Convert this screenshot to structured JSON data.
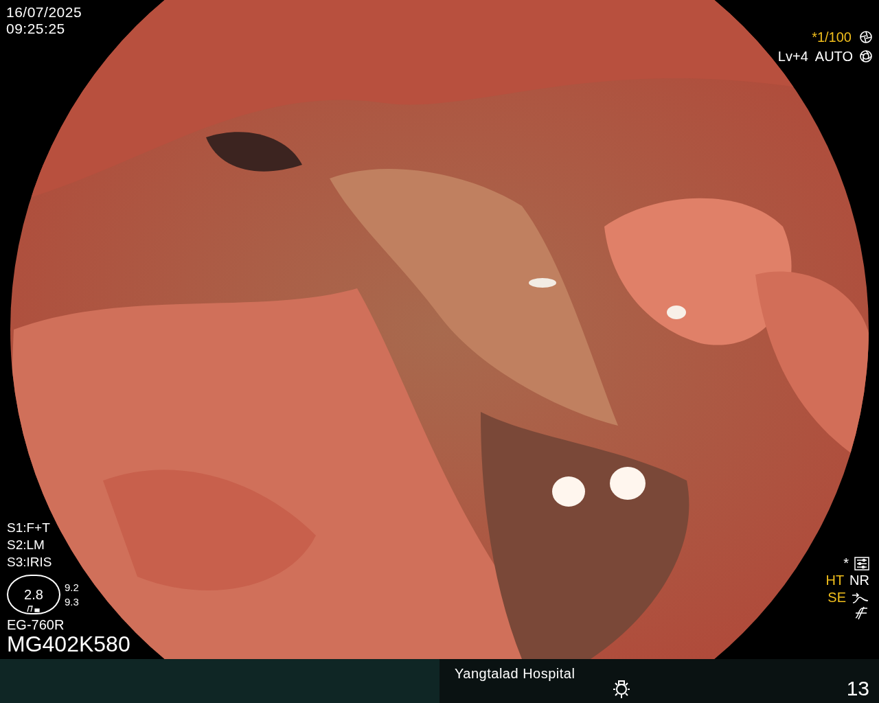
{
  "top_left": {
    "date": "16/07/2025",
    "time": "09:25:25"
  },
  "top_right": [
    {
      "text": "*1/100",
      "color": "#f2bf1c"
    },
    {
      "text": "Lv+4",
      "color": "#ffffff"
    },
    {
      "text": "AUTO",
      "color": "#ffffff"
    }
  ],
  "scope_settings": [
    "S1:F+T",
    "S2:LM",
    "S3:IRIS"
  ],
  "gauge": {
    "value": "2.8",
    "readings": [
      "9.2",
      "9.3"
    ]
  },
  "scope_model": "EG-760R",
  "scope_serial": "MG402K580",
  "image_modes": [
    [
      {
        "text": "*",
        "color": "#ffffff"
      }
    ],
    [
      {
        "text": "HT",
        "color": "#f2bf1c"
      },
      {
        "text": "NR",
        "color": "#ffffff"
      }
    ],
    [
      {
        "text": "SE",
        "color": "#f2bf1c"
      }
    ]
  ],
  "status_bar": {
    "hospital": "Yangtalad Hospital",
    "count": "13"
  }
}
